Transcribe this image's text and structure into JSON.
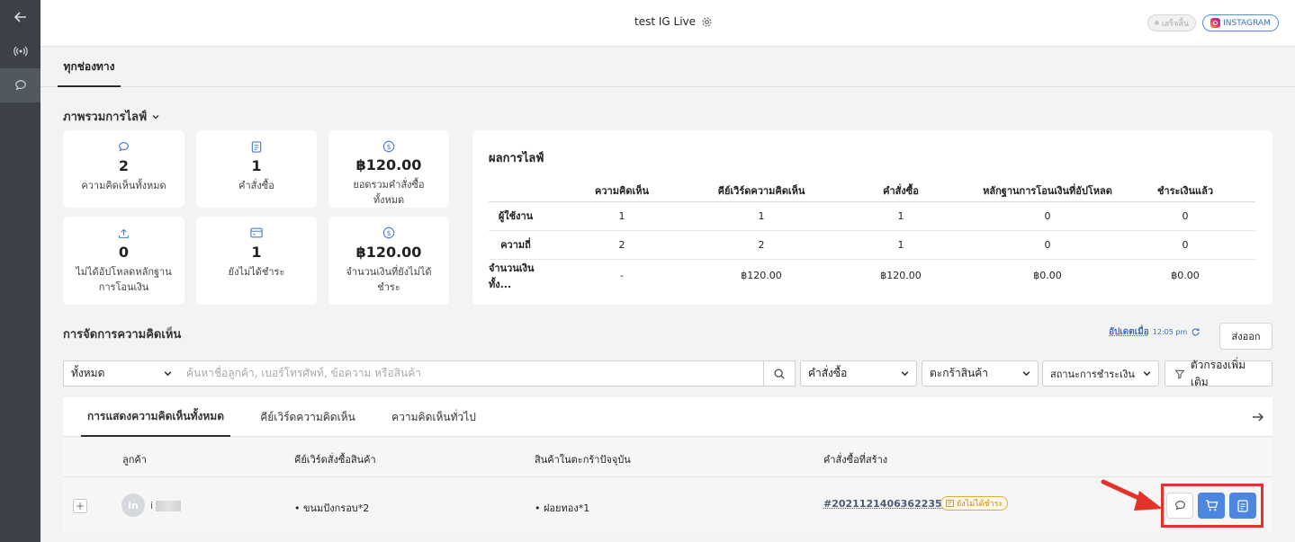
{
  "header": {
    "title": "test IG Live",
    "status_label": "เสร็จสิ้น",
    "channel_label": "INSTAGRAM"
  },
  "channel_tabs": [
    {
      "label": "ทุกช่องทาง",
      "active": true
    }
  ],
  "overview": {
    "title": "ภาพรวมการไลฟ์",
    "stats": [
      {
        "icon": "comment-icon",
        "value": "2",
        "label": "ความคิดเห็นทั้งหมด"
      },
      {
        "icon": "order-icon",
        "value": "1",
        "label": "คำสั่งซื้อ"
      },
      {
        "icon": "baht-icon",
        "value": "฿120.00",
        "label": "ยอดรวมคำสั่งซื้อทั้งหมด"
      },
      {
        "icon": "upload-icon",
        "value": "0",
        "label": "ไม่ได้อัปโหลดหลักฐานการโอนเงิน"
      },
      {
        "icon": "card-icon",
        "value": "1",
        "label": "ยังไม่ได้ชำระ"
      },
      {
        "icon": "baht-icon",
        "value": "฿120.00",
        "label": "จำนวนเงินที่ยังไม่ได้ชำระ"
      }
    ]
  },
  "results": {
    "title": "ผลการไลฟ์",
    "columns": [
      "",
      "ความคิดเห็น",
      "คีย์เวิร์ดความคิดเห็น",
      "คำสั่งซื้อ",
      "หลักฐานการโอนเงินที่อัปโหลด",
      "ชำระเงินแล้ว"
    ],
    "rows": [
      [
        "ผู้ใช้งาน",
        "1",
        "1",
        "1",
        "0",
        "0"
      ],
      [
        "ความถี่",
        "2",
        "2",
        "1",
        "0",
        "0"
      ],
      [
        "จำนวนเงินทั้ง...",
        "-",
        "฿120.00",
        "฿120.00",
        "฿0.00",
        "฿0.00"
      ]
    ]
  },
  "comments": {
    "title": "การจัดการความคิดเห็น",
    "updated_label": "อัปเดตเมื่อ",
    "updated_time": "12:05 pm",
    "export_label": "ส่งออก",
    "filter_scope": "ทั้งหมด",
    "search_placeholder": "ค้นหาชื่อลูกค้า, เบอร์โทรศัพท์, ข้อความ หรือสินค้า",
    "filter_order": "คำสั่งซื้อ",
    "filter_cart": "ตะกร้าสินค้า",
    "filter_payment": "สถานะการชำระเงิน",
    "more_filters": "ตัวกรองเพิ่มเติม",
    "tabs": [
      "การแสดงความคิดเห็นทั้งหมด",
      "คีย์เวิร์ดความคิดเห็น",
      "ความคิดเห็นทั่วไป"
    ],
    "table_headers": [
      "ลูกค้า",
      "คีย์เวิร์ดสั่งซื้อสินค้า",
      "สินค้าในตะกร้าปัจจุบัน",
      "คำสั่งซื้อที่สร้าง"
    ],
    "row": {
      "customer_initial": "in",
      "customer_name": "i",
      "keyword": "• ขนมปังกรอบ*2",
      "cart": "• ฝอยทอง*1",
      "order_id": "#20211214063622356",
      "order_status": "ยังไม่ได้ชำระ"
    }
  },
  "colors": {
    "sidebar": "#3c4147",
    "accent": "#4c86e0",
    "highlight": "#e4322b",
    "warning": "#e2a93b"
  }
}
